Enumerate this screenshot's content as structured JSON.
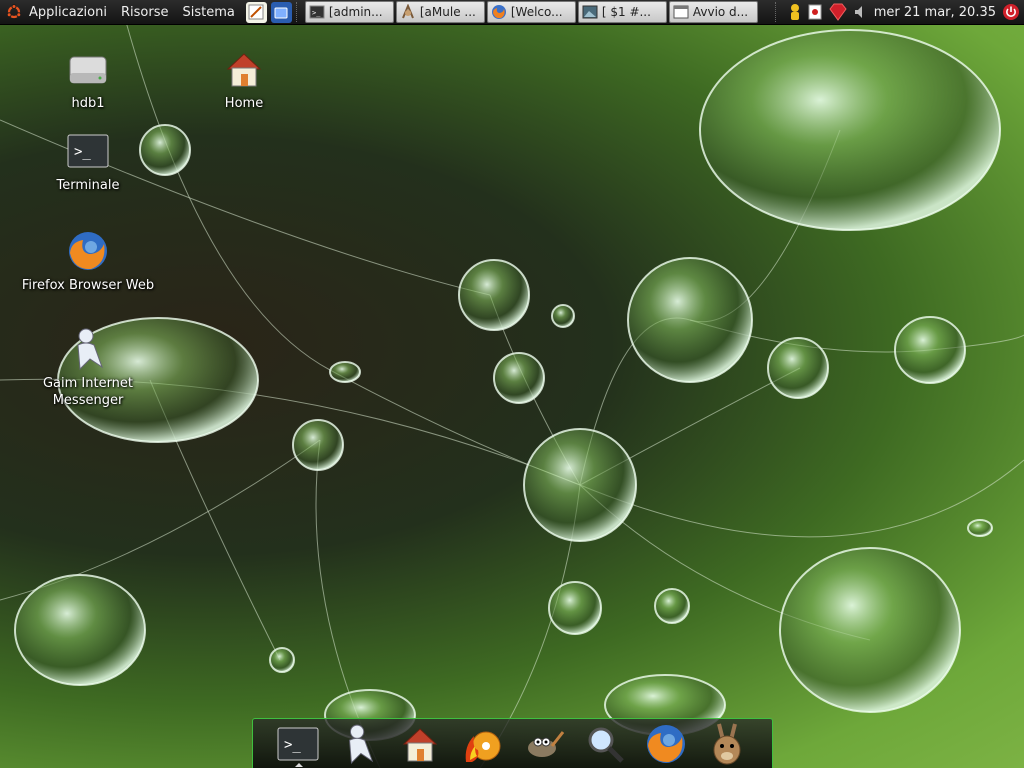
{
  "top_panel": {
    "menus": [
      "Applicazioni",
      "Risorse",
      "Sistema"
    ],
    "tasks": [
      {
        "label": "[admin...",
        "icon": "terminal-icon"
      },
      {
        "label": "[aMule ...",
        "icon": "amule-icon"
      },
      {
        "label": "[Welco...",
        "icon": "firefox-icon"
      },
      {
        "label": "[ $1 #...",
        "icon": "image-icon"
      },
      {
        "label": "Avvio d...",
        "icon": "window-icon"
      }
    ],
    "clock": "mer 21 mar, 20.35"
  },
  "desktop_icons": [
    {
      "label": "hdb1",
      "icon": "drive-icon"
    },
    {
      "label": "Home",
      "icon": "home-icon"
    },
    {
      "label": "Terminale",
      "icon": "terminal-icon"
    },
    {
      "label": "Firefox Browser Web",
      "icon": "firefox-icon"
    },
    {
      "label": "Gaim Internet Messenger",
      "icon": "gaim-icon"
    }
  ],
  "dock_items": [
    "terminal-icon",
    "gaim-icon",
    "home-icon",
    "burner-icon",
    "gimp-icon",
    "search-icon",
    "firefox-icon",
    "amule-icon"
  ],
  "colors": {
    "panel": "#1c1c1c",
    "dock_border": "#3fbf3f",
    "accent_orange": "#e95420"
  }
}
